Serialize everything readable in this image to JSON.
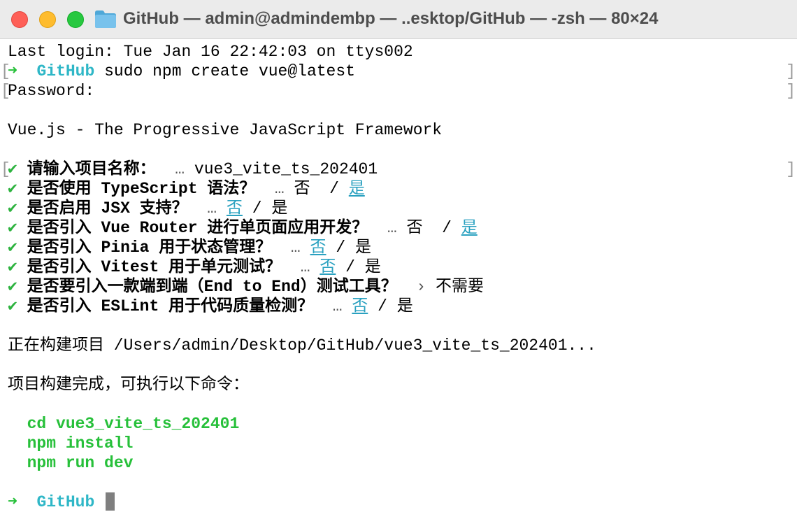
{
  "window": {
    "title": "GitHub — admin@admindembp — ..esktop/GitHub — -zsh — 80×24",
    "folder_icon": "folder-icon",
    "colors": {
      "close": "#fe5f57",
      "minimize": "#febc2e",
      "zoom": "#28c840",
      "prompt_arrow": "#27c03a",
      "prompt_dir": "#2fb7c7",
      "link": "#2aa1c0"
    }
  },
  "terminal": {
    "last_login": "Last login: Tue Jan 16 22:42:03 on ttys002",
    "prompt_arrow": "➜",
    "prompt_dir": "GitHub",
    "command": "sudo npm create vue@latest",
    "password_label": "Password:",
    "banner": "Vue.js - The Progressive JavaScript Framework",
    "check": "✔",
    "ellipsis": "…",
    "slash": "/",
    "questions": [
      {
        "label": "请输入项目名称：",
        "answer": "vue3_vite_ts_202401"
      },
      {
        "label": "是否使用 TypeScript 语法？",
        "no": "否",
        "yes": "是",
        "selected": "yes"
      },
      {
        "label": "是否启用 JSX 支持？",
        "no": "否",
        "yes": "是",
        "selected": "no"
      },
      {
        "label": "是否引入 Vue Router 进行单页面应用开发？",
        "no": "否",
        "yes": "是",
        "selected": "yes"
      },
      {
        "label": "是否引入 Pinia 用于状态管理？",
        "no": "否",
        "yes": "是",
        "selected": "no"
      },
      {
        "label": "是否引入 Vitest 用于单元测试？",
        "no": "否",
        "yes": "是",
        "selected": "no"
      },
      {
        "label": "是否要引入一款端到端（End to End）测试工具？",
        "marker": "›",
        "answer": "不需要"
      },
      {
        "label": "是否引入 ESLint 用于代码质量检测？",
        "no": "否",
        "yes": "是",
        "selected": "no"
      }
    ],
    "building": "正在构建项目 /Users/admin/Desktop/GitHub/vue3_vite_ts_202401...",
    "done": "项目构建完成，可执行以下命令：",
    "next_commands": [
      "cd vue3_vite_ts_202401",
      "npm install",
      "npm run dev"
    ]
  }
}
